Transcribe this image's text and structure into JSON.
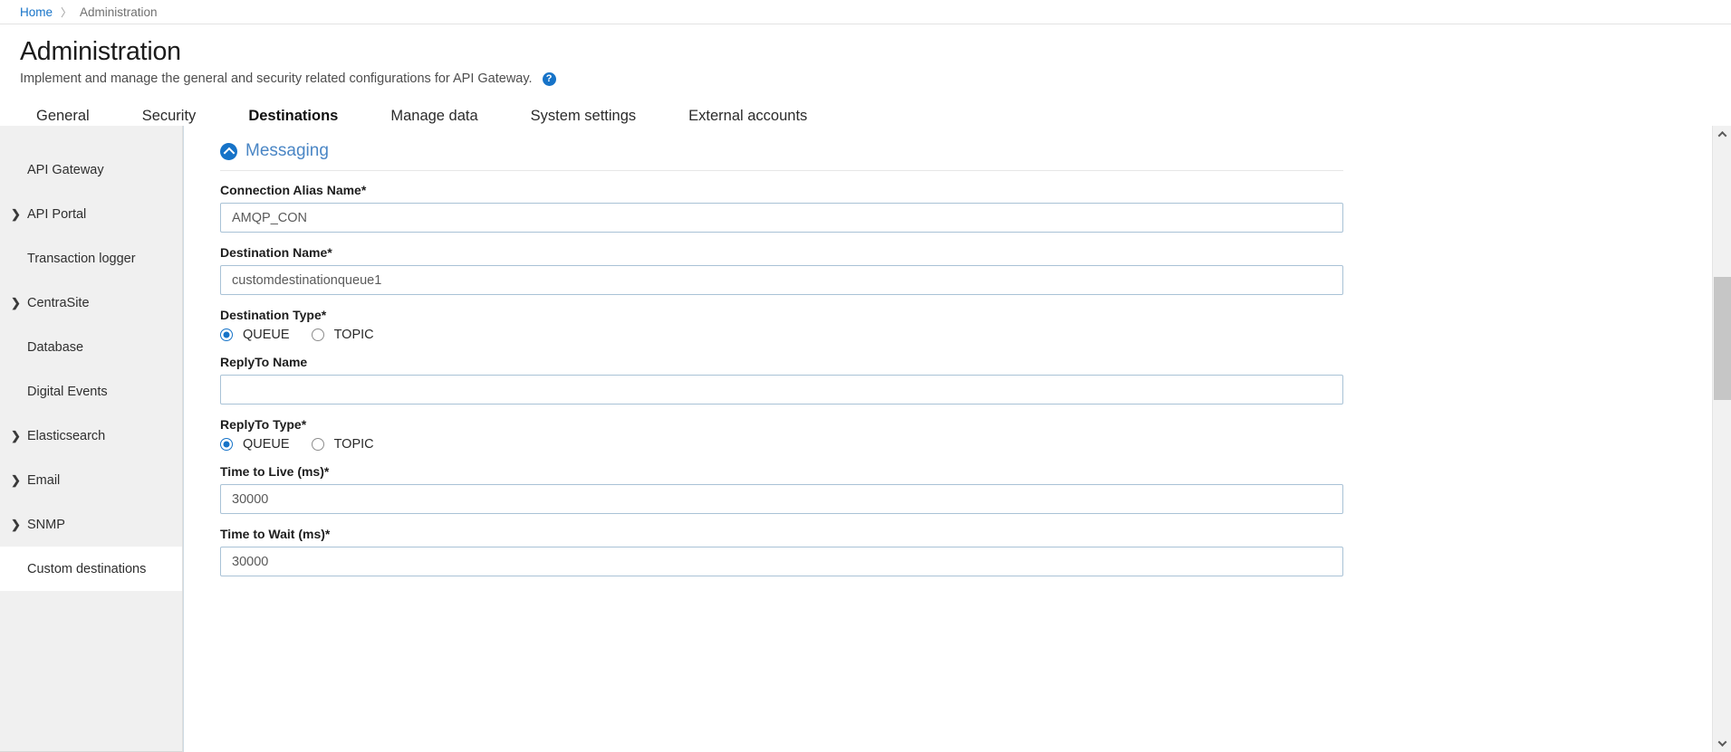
{
  "breadcrumb": {
    "home": "Home",
    "separator": "〉",
    "current": "Administration"
  },
  "header": {
    "title": "Administration",
    "subtitle": "Implement and manage the general and security related configurations for API Gateway.",
    "help_icon": "question-mark-icon",
    "help_glyph": "?"
  },
  "tabs": [
    {
      "label": "General",
      "active": false
    },
    {
      "label": "Security",
      "active": false
    },
    {
      "label": "Destinations",
      "active": true
    },
    {
      "label": "Manage data",
      "active": false
    },
    {
      "label": "System settings",
      "active": false
    },
    {
      "label": "External accounts",
      "active": false
    }
  ],
  "sidebar": {
    "items": [
      {
        "label": "API Gateway",
        "expandable": false,
        "active": false
      },
      {
        "label": "API Portal",
        "expandable": true,
        "active": false
      },
      {
        "label": "Transaction logger",
        "expandable": false,
        "active": false
      },
      {
        "label": "CentraSite",
        "expandable": true,
        "active": false
      },
      {
        "label": "Database",
        "expandable": false,
        "active": false
      },
      {
        "label": "Digital Events",
        "expandable": false,
        "active": false
      },
      {
        "label": "Elasticsearch",
        "expandable": true,
        "active": false
      },
      {
        "label": "Email",
        "expandable": true,
        "active": false
      },
      {
        "label": "SNMP",
        "expandable": true,
        "active": false
      },
      {
        "label": "Custom destinations",
        "expandable": false,
        "active": true
      }
    ],
    "chevron_glyph": "❯"
  },
  "section": {
    "title": "Messaging",
    "collapse_icon": "circle-arrow-up-icon"
  },
  "form": {
    "connection_alias": {
      "label": "Connection Alias Name*",
      "value": "AMQP_CON",
      "placeholder": ""
    },
    "destination_name": {
      "label": "Destination Name*",
      "value": "customdestinationqueue1",
      "placeholder": ""
    },
    "destination_type": {
      "label": "Destination Type*",
      "options": [
        "QUEUE",
        "TOPIC"
      ],
      "selected": "QUEUE"
    },
    "replyto_name": {
      "label": "ReplyTo Name",
      "value": "",
      "placeholder": ""
    },
    "replyto_type": {
      "label": "ReplyTo Type*",
      "options": [
        "QUEUE",
        "TOPIC"
      ],
      "selected": "QUEUE"
    },
    "time_to_live": {
      "label": "Time to Live (ms)*",
      "value": "30000",
      "placeholder": ""
    },
    "time_to_wait": {
      "label": "Time to Wait (ms)*",
      "value": "30000",
      "placeholder": ""
    }
  },
  "scrollbar": {
    "up_arrow": "chevron-up-icon",
    "down_arrow": "chevron-down-icon"
  },
  "colors": {
    "accent": "#1673c8",
    "section_title": "#4a86c5",
    "sidebar_bg": "#f0f0f0",
    "input_border": "#a9c2d6"
  }
}
